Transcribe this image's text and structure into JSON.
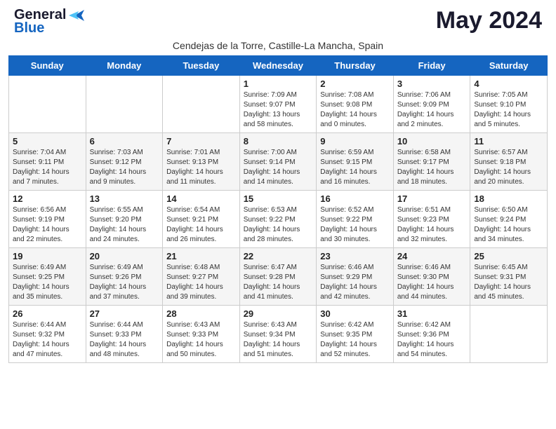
{
  "header": {
    "logo_general": "General",
    "logo_blue": "Blue",
    "month_title": "May 2024",
    "location": "Cendejas de la Torre, Castille-La Mancha, Spain"
  },
  "days_of_week": [
    "Sunday",
    "Monday",
    "Tuesday",
    "Wednesday",
    "Thursday",
    "Friday",
    "Saturday"
  ],
  "weeks": [
    [
      {
        "day": "",
        "content": ""
      },
      {
        "day": "",
        "content": ""
      },
      {
        "day": "",
        "content": ""
      },
      {
        "day": "1",
        "content": "Sunrise: 7:09 AM\nSunset: 9:07 PM\nDaylight: 13 hours\nand 58 minutes."
      },
      {
        "day": "2",
        "content": "Sunrise: 7:08 AM\nSunset: 9:08 PM\nDaylight: 14 hours\nand 0 minutes."
      },
      {
        "day": "3",
        "content": "Sunrise: 7:06 AM\nSunset: 9:09 PM\nDaylight: 14 hours\nand 2 minutes."
      },
      {
        "day": "4",
        "content": "Sunrise: 7:05 AM\nSunset: 9:10 PM\nDaylight: 14 hours\nand 5 minutes."
      }
    ],
    [
      {
        "day": "5",
        "content": "Sunrise: 7:04 AM\nSunset: 9:11 PM\nDaylight: 14 hours\nand 7 minutes."
      },
      {
        "day": "6",
        "content": "Sunrise: 7:03 AM\nSunset: 9:12 PM\nDaylight: 14 hours\nand 9 minutes."
      },
      {
        "day": "7",
        "content": "Sunrise: 7:01 AM\nSunset: 9:13 PM\nDaylight: 14 hours\nand 11 minutes."
      },
      {
        "day": "8",
        "content": "Sunrise: 7:00 AM\nSunset: 9:14 PM\nDaylight: 14 hours\nand 14 minutes."
      },
      {
        "day": "9",
        "content": "Sunrise: 6:59 AM\nSunset: 9:15 PM\nDaylight: 14 hours\nand 16 minutes."
      },
      {
        "day": "10",
        "content": "Sunrise: 6:58 AM\nSunset: 9:17 PM\nDaylight: 14 hours\nand 18 minutes."
      },
      {
        "day": "11",
        "content": "Sunrise: 6:57 AM\nSunset: 9:18 PM\nDaylight: 14 hours\nand 20 minutes."
      }
    ],
    [
      {
        "day": "12",
        "content": "Sunrise: 6:56 AM\nSunset: 9:19 PM\nDaylight: 14 hours\nand 22 minutes."
      },
      {
        "day": "13",
        "content": "Sunrise: 6:55 AM\nSunset: 9:20 PM\nDaylight: 14 hours\nand 24 minutes."
      },
      {
        "day": "14",
        "content": "Sunrise: 6:54 AM\nSunset: 9:21 PM\nDaylight: 14 hours\nand 26 minutes."
      },
      {
        "day": "15",
        "content": "Sunrise: 6:53 AM\nSunset: 9:22 PM\nDaylight: 14 hours\nand 28 minutes."
      },
      {
        "day": "16",
        "content": "Sunrise: 6:52 AM\nSunset: 9:22 PM\nDaylight: 14 hours\nand 30 minutes."
      },
      {
        "day": "17",
        "content": "Sunrise: 6:51 AM\nSunset: 9:23 PM\nDaylight: 14 hours\nand 32 minutes."
      },
      {
        "day": "18",
        "content": "Sunrise: 6:50 AM\nSunset: 9:24 PM\nDaylight: 14 hours\nand 34 minutes."
      }
    ],
    [
      {
        "day": "19",
        "content": "Sunrise: 6:49 AM\nSunset: 9:25 PM\nDaylight: 14 hours\nand 35 minutes."
      },
      {
        "day": "20",
        "content": "Sunrise: 6:49 AM\nSunset: 9:26 PM\nDaylight: 14 hours\nand 37 minutes."
      },
      {
        "day": "21",
        "content": "Sunrise: 6:48 AM\nSunset: 9:27 PM\nDaylight: 14 hours\nand 39 minutes."
      },
      {
        "day": "22",
        "content": "Sunrise: 6:47 AM\nSunset: 9:28 PM\nDaylight: 14 hours\nand 41 minutes."
      },
      {
        "day": "23",
        "content": "Sunrise: 6:46 AM\nSunset: 9:29 PM\nDaylight: 14 hours\nand 42 minutes."
      },
      {
        "day": "24",
        "content": "Sunrise: 6:46 AM\nSunset: 9:30 PM\nDaylight: 14 hours\nand 44 minutes."
      },
      {
        "day": "25",
        "content": "Sunrise: 6:45 AM\nSunset: 9:31 PM\nDaylight: 14 hours\nand 45 minutes."
      }
    ],
    [
      {
        "day": "26",
        "content": "Sunrise: 6:44 AM\nSunset: 9:32 PM\nDaylight: 14 hours\nand 47 minutes."
      },
      {
        "day": "27",
        "content": "Sunrise: 6:44 AM\nSunset: 9:33 PM\nDaylight: 14 hours\nand 48 minutes."
      },
      {
        "day": "28",
        "content": "Sunrise: 6:43 AM\nSunset: 9:33 PM\nDaylight: 14 hours\nand 50 minutes."
      },
      {
        "day": "29",
        "content": "Sunrise: 6:43 AM\nSunset: 9:34 PM\nDaylight: 14 hours\nand 51 minutes."
      },
      {
        "day": "30",
        "content": "Sunrise: 6:42 AM\nSunset: 9:35 PM\nDaylight: 14 hours\nand 52 minutes."
      },
      {
        "day": "31",
        "content": "Sunrise: 6:42 AM\nSunset: 9:36 PM\nDaylight: 14 hours\nand 54 minutes."
      },
      {
        "day": "",
        "content": ""
      }
    ]
  ]
}
